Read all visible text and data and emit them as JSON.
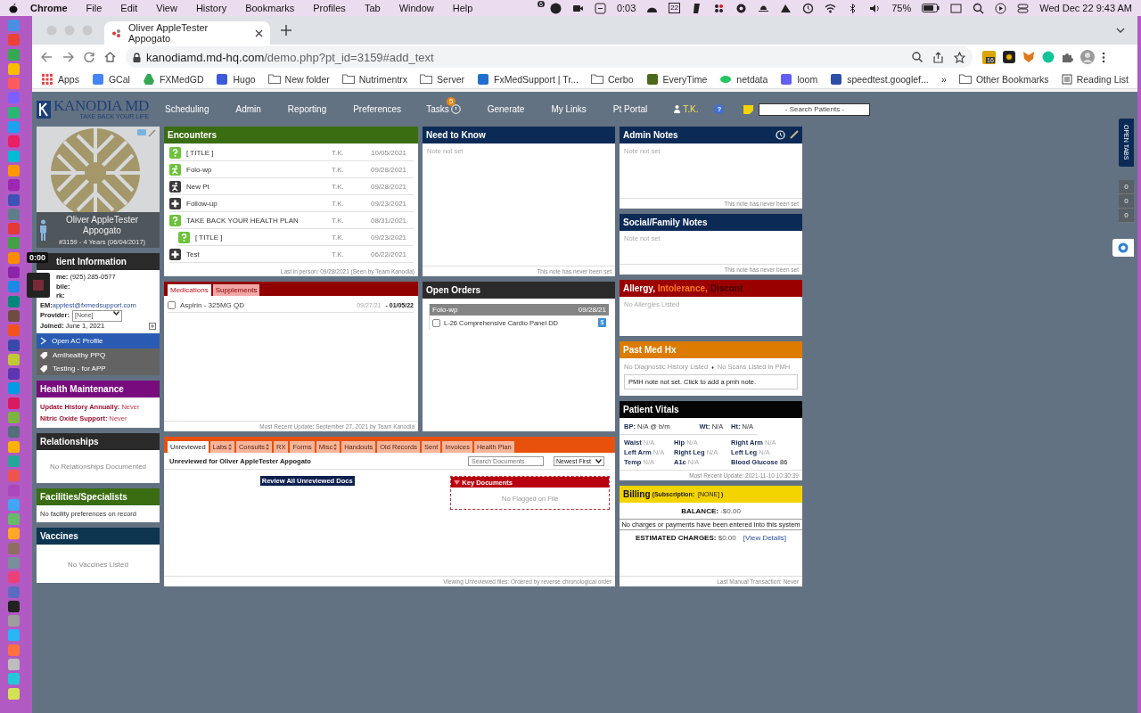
{
  "menubar": {
    "app": "Chrome",
    "items": [
      "File",
      "Edit",
      "View",
      "History",
      "Bookmarks",
      "Profiles",
      "Tab",
      "Window",
      "Help"
    ],
    "status_badge": "6",
    "timer": "0:03",
    "calendar_day": "22",
    "battery": "75%",
    "clock": "Wed Dec 22  9:43 AM"
  },
  "browser": {
    "tab_title": "Oliver AppleTester Appogato",
    "url_host": "kanodiamd.md-hq.com",
    "url_path": "/demo.php?pt_id=3159#add_text",
    "extension_badge": "16",
    "bookmarks": [
      {
        "label": "Apps",
        "kind": "apps",
        "color": "#e8453c"
      },
      {
        "label": "GCal",
        "kind": "site",
        "color": "#4285f4"
      },
      {
        "label": "FXMedGD",
        "kind": "drive",
        "color": "#34a853"
      },
      {
        "label": "Hugo",
        "kind": "site",
        "color": "#3b5bdb"
      },
      {
        "label": "New folder",
        "kind": "folder",
        "color": "#6b6b6b"
      },
      {
        "label": "Nutrimentrx",
        "kind": "folder",
        "color": "#6b6b6b"
      },
      {
        "label": "Server",
        "kind": "folder",
        "color": "#6b6b6b"
      },
      {
        "label": "FxMedSupport | Tr...",
        "kind": "site",
        "color": "#1f6fd1"
      },
      {
        "label": "Cerbo",
        "kind": "folder",
        "color": "#6b6b6b"
      },
      {
        "label": "EveryTime",
        "kind": "site",
        "color": "#4a6a1a"
      },
      {
        "label": "netdata",
        "kind": "leaf",
        "color": "#22c55e"
      },
      {
        "label": "loom",
        "kind": "site",
        "color": "#625df5"
      },
      {
        "label": "speedtest.googlef...",
        "kind": "site",
        "color": "#2b4fa8"
      }
    ],
    "more": "»",
    "other_bookmarks": "Other Bookmarks",
    "reading_list": "Reading List"
  },
  "nav": {
    "logo": "KANODIA MD",
    "tagline": "TAKE BACK YOUR LIFE",
    "items": [
      "Scheduling",
      "Admin",
      "Reporting",
      "Preferences"
    ],
    "tasks": {
      "label": "Tasks",
      "badge": "5"
    },
    "items_after": [
      "Generate",
      "My Links",
      "Pt Portal"
    ],
    "user": "T.K.",
    "help": "?",
    "search": {
      "placeholder": "- Search Patients -"
    }
  },
  "patient": {
    "name": "Oliver AppleTester Appogato",
    "id_line": "#3159 - 4 Years (06/04/2017)"
  },
  "patient_info": {
    "title": "tient Information",
    "lines": [
      {
        "label": "me:",
        "value": "(925) 285-0577"
      },
      {
        "label": "bile:"
      },
      {
        "label": "rk:"
      }
    ],
    "email": {
      "label": "EM:",
      "value": "apptest@fxmedsupport.com"
    },
    "provider": {
      "label": "Provider:",
      "value": "[None]"
    },
    "joined": {
      "label": "Joined:",
      "value": "June 1, 2021"
    },
    "actions": [
      {
        "label": "Open AC Profile",
        "kind": "primary"
      },
      {
        "label": "AmIhealthy PPQ",
        "kind": "tag"
      },
      {
        "label": "Testing - for APP",
        "kind": "tag"
      }
    ]
  },
  "health_maintenance": {
    "title": "Health Maintenance",
    "items": [
      {
        "label": "Update History Annually:",
        "value": "Never"
      },
      {
        "label": "Nitric Oxide Support:",
        "value": "Never"
      }
    ]
  },
  "relationships": {
    "title": "Relationships",
    "empty": "No Relationships Documented"
  },
  "facilities": {
    "title": "Facilities/Specialists",
    "empty": "No facility preferences on record"
  },
  "vaccines": {
    "title": "Vaccines",
    "empty": "No Vaccines Listed"
  },
  "encounters": {
    "title": "Encounters",
    "rows": [
      {
        "kind": "question",
        "title": "[ TITLE ]",
        "provider": "T.K.",
        "date": "10/05/2021"
      },
      {
        "kind": "runner",
        "title": "Folo-wp",
        "provider": "T.K.",
        "date": "09/28/2021"
      },
      {
        "kind": "runner_dark",
        "title": "New Pt",
        "provider": "T.K.",
        "date": "09/28/2021"
      },
      {
        "kind": "plus",
        "title": "Follow-up",
        "provider": "T.K.",
        "date": "09/23/2021"
      },
      {
        "kind": "question",
        "title": "TAKE BACK YOUR HEALTH PLAN",
        "provider": "T.K.",
        "date": "08/31/2021",
        "children": [
          {
            "kind": "question",
            "title": "[ TITLE ]",
            "provider": "T.K.",
            "date": "09/23/2021"
          }
        ]
      },
      {
        "kind": "plus",
        "title": "Test",
        "provider": "T.K.",
        "date": "06/22/2021"
      }
    ],
    "footer": "Last in person: 09/28/2021 (Seen by Team Kanodia)"
  },
  "need_to_know": {
    "title": "Need to Know",
    "note": "Note not set",
    "footer": "This note has never been set"
  },
  "admin_notes": {
    "title": "Admin Notes",
    "note": "Note not set",
    "footer": "This note has never been set"
  },
  "social_notes": {
    "title": "Social/Family Notes",
    "note": "Note not set",
    "footer": "This note has never been set"
  },
  "medications": {
    "tabs": [
      {
        "label": "Medications",
        "selected": true
      },
      {
        "label": "Supplements",
        "selected": false
      }
    ],
    "items": [
      {
        "name": "Aspirin - 325MG QD",
        "start": "09/27/21",
        "end": "- 01/05/22",
        "checked": false
      }
    ],
    "footer": "Most Recent Update: September 27, 2021 by Team Kanodia"
  },
  "open_orders": {
    "title": "Open Orders",
    "groups": [
      {
        "title": "Folo-wp",
        "date": "09/28/21",
        "items": [
          {
            "name": "L-26 Comprehensive Cardio Panel DD",
            "checked": false,
            "badge": "$"
          }
        ]
      }
    ]
  },
  "allergy": {
    "title_parts": [
      {
        "text": "Allergy,",
        "color": "#ffffff"
      },
      {
        "text": "Intolerance,",
        "color": "#ff7a1a"
      },
      {
        "text": "Discont",
        "color": "#3a0000"
      }
    ],
    "empty": "No Allergies Listed"
  },
  "past_med_hx": {
    "title": "Past Med Hx",
    "diagnostic": "No Diagnostic History Listed",
    "separator": "♦",
    "scans": "No Scans Listed in PMH",
    "note": "PMH note not set. Click to add a pmh note."
  },
  "vitals": {
    "title": "Patient Vitals",
    "top": [
      {
        "label": "BP:",
        "value": "N/A @ b/m"
      },
      {
        "label": "Wt:",
        "value": "N/A"
      },
      {
        "label": "Ht:",
        "value": "N/A"
      }
    ],
    "grid": [
      {
        "label": "Waist",
        "value": "N/A",
        "empty": true
      },
      {
        "label": "Hip",
        "value": "N/A",
        "empty": true
      },
      {
        "label": "Right Arm",
        "value": "N/A",
        "empty": true
      },
      {
        "label": "Left Arm",
        "value": "N/A",
        "empty": true
      },
      {
        "label": "Right Leg",
        "value": "N/A",
        "empty": true
      },
      {
        "label": "Left Leg",
        "value": "N/A",
        "empty": true
      },
      {
        "label": "Temp",
        "value": "N/A",
        "empty": true
      },
      {
        "label": "A1c",
        "value": "N/A",
        "empty": true
      },
      {
        "label": "Blood Glucose",
        "value": "86",
        "empty": false
      }
    ],
    "footer": "Most Recent Update: 2021-11-10 10:30:39"
  },
  "billing": {
    "title": "Billing",
    "subscription_label": "(Subscription:",
    "subscription_value": "[NONE]",
    "subscription_close": ")",
    "balance_label": "BALANCE:",
    "balance_value": "-$0.00",
    "note": "No charges or payments have been entered into this system",
    "estimated_label": "ESTIMATED CHARGES:",
    "estimated_value": "$0.00",
    "details_link": "[View Details]",
    "footer": "Last Manual Transaction: Never"
  },
  "documents": {
    "tabs": [
      {
        "label": "Unreviewed",
        "selected": true,
        "sort_icon": false
      },
      {
        "label": "Labs",
        "selected": false,
        "sort_icon": true
      },
      {
        "label": "Consults",
        "selected": false,
        "sort_icon": true
      },
      {
        "label": "RX",
        "selected": false,
        "sort_icon": false
      },
      {
        "label": "Forms",
        "selected": false,
        "sort_icon": false
      },
      {
        "label": "Misc",
        "selected": false,
        "sort_icon": true
      },
      {
        "label": "Handouts",
        "selected": false,
        "sort_icon": false
      },
      {
        "label": "Old Records",
        "selected": false,
        "sort_icon": false
      },
      {
        "label": "Sent",
        "selected": false,
        "sort_icon": false
      },
      {
        "label": "Invoices",
        "selected": false,
        "sort_icon": false
      },
      {
        "label": "Health Plan",
        "selected": false,
        "sort_icon": false
      }
    ],
    "heading": "Unreviewed for Oliver AppleTester Appogato",
    "search": {
      "placeholder": "Search Documents"
    },
    "sort": "Newest First",
    "review_button": "Review All Unreviewed Docs",
    "key_documents": {
      "title": "Key Documents",
      "empty": "No Flagged on File"
    },
    "footer": "Viewing Unreviewed files: Ordered by reverse chronological order"
  },
  "side_tabs": {
    "label": "OPEN TABS",
    "counters": [
      "0",
      "0",
      "0"
    ]
  },
  "recorder": {
    "time": "0:00"
  }
}
